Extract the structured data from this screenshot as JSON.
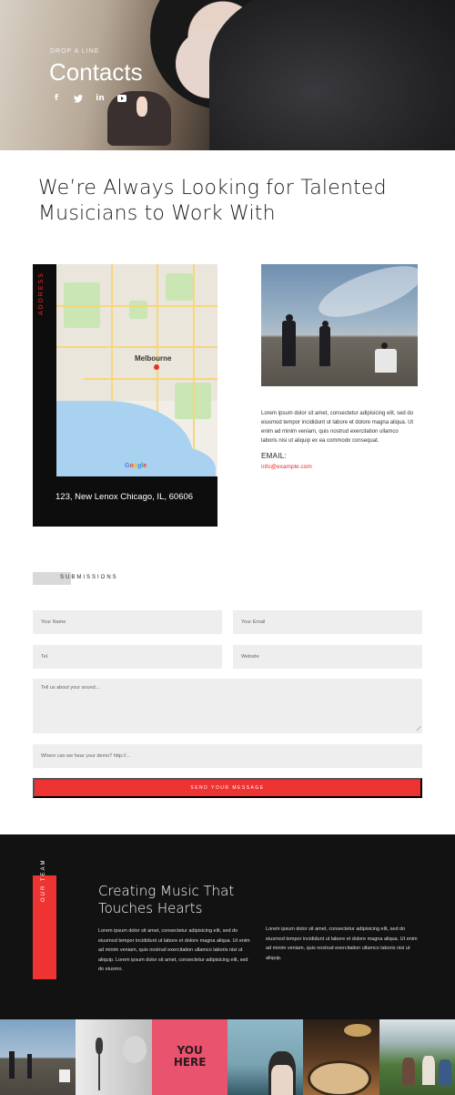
{
  "hero": {
    "kicker": "DROP A LINE",
    "title": "Contacts",
    "social_icons": [
      "facebook-icon",
      "twitter-icon",
      "linkedin-icon",
      "youtube-icon"
    ]
  },
  "headline": "We’re Always Looking for Talented Musicians to Work With",
  "address": {
    "vertical_label": "ADDRESS",
    "text": "123, New Lenox Chicago, IL, 60606",
    "map": {
      "city": "Melbourne",
      "attribution": "Google"
    }
  },
  "contact": {
    "body": "Lorem ipsum dolor sit amet, consectetur adipisicing elit, sed do eiusmod tempor incididunt ut labore et dolore magna aliqua. Ut enim ad minim veniam, quis nostrud exercitation ullamco laboris nisi ut aliquip ex ea commodo consequat.",
    "email_label": "EMAIL:",
    "email_value": "info@example.com"
  },
  "form": {
    "section_label": "SUBMISSIONS",
    "name_placeholder": "Your Name",
    "email_placeholder": "Your Email",
    "tel_placeholder": "Tel.",
    "website_placeholder": "Website",
    "sound_placeholder": "Tell us about your sound...",
    "demo_placeholder": "Where can we hear your demo? http://...",
    "submit_label": "SEND YOUR MESSAGE"
  },
  "team": {
    "vertical_label": "OUR TEAM",
    "title": "Creating Music That Touches Hearts",
    "col1": "Lorem ipsum dolor sit amet, consectetur adipisicing elit, sed do eiusmod tempor incididunt ut labore et dolore magna aliqua. Ut enim ad minim veniam, quis nostrud exercitation ullamco laboris nisi ut aliquip. Lorem ipsum dolor sit amet, consectetur adipisicing elit, sed do eiusmo.",
    "col2": "Lorem ipsum dolor sit amet, consectetur adipisicing elit, sed do eiusmod tempor incididunt ut labore et dolore magna aliqua. Ut enim ad minim veniam, quis nostrud exercitation ullamco laboris nisi ut aliquip."
  },
  "gallery": {
    "sign_text": "YOU HERE"
  },
  "colors": {
    "accent": "#ee3333",
    "dark": "#121212",
    "field_bg": "#eeeeee"
  }
}
